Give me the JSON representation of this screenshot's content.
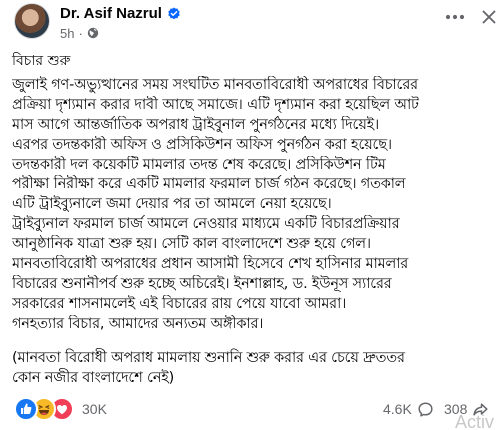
{
  "author": {
    "name": "Dr. Asif Nazrul",
    "verified_icon": "verified-badge-icon",
    "time": "5h",
    "separator": "·",
    "audience_icon": "globe-icon"
  },
  "header": {
    "more_icon": "more-horizontal-icon",
    "close_icon": "close-icon"
  },
  "post": {
    "title": "বিচার শুরু",
    "body_lines": [
      "জুলাই গণ-অভ্যুত্থানের সময় সংঘটিত মানবতাবিরোধী অপরাধের বিচারের",
      "প্রক্রিয়া দৃশ্যমান করার দাবী আছে সমাজে। এটি দৃশ্যমান করা হয়েছিল আট",
      "মাস আগে আন্তর্জাতিক অপরাধ ট্রাইবুনাল পুনর্গঠনের মধ্যে দিয়েই।",
      "এরপর তদন্তকারী অফিস ও প্রসিকিউশন অফিস পুনর্গঠন করা হয়েছে।",
      "তদন্তকারী দল কয়েকটি মামলার তদন্ত শেষ করেছে। প্রসিকিউশন টিম",
      "পরীক্ষা নিরীক্ষা করে একটি মামলার ফরমাল চার্জ গঠন করেছে। গতকাল",
      "এটি ট্রাইব্যুনালে জমা দেয়ার পর তা আমলে নেয়া হয়েছে।",
      "ট্রাইব্যুনাল ফরমাল চার্জ আমলে নেওয়ার মাধ্যমে একটি বিচারপ্রক্রিয়ার",
      "আনুষ্ঠানিক যাত্রা শুরু হয়। সেটি কাল বাংলাদেশে শুরু হয়ে গেল।",
      "মানবতাবিরোধী অপরাধের প্রধান আসামী হিসেবে শেখ হাসিনার মামলার",
      "বিচারের শুনানীপর্ব শুরু হচ্ছে অচিরেই। ইনশাল্লাহ, ড. ইউনূস স্যারের",
      "সরকারের শাসনামলেই এই বিচারের রায় পেয়ে যাবো আমরা।",
      "গনহত্যার বিচার, আমাদের অন্যতম অঙ্গীকার।"
    ],
    "note_lines": [
      "(মানবতা বিরোধী অপরাধ মামলায় শুনানি  শুরু করার এর চেয়ে দ্রুততর",
      "কোন নজীর বাংলাদেশে নেই)"
    ]
  },
  "footer": {
    "reaction_icons": [
      "like-icon",
      "haha-icon",
      "love-icon"
    ],
    "reaction_count": "30K",
    "comment_count": "4.6K",
    "comment_icon": "comment-icon",
    "share_count": "308",
    "share_icon": "share-icon"
  },
  "watermark": "Activ",
  "colors": {
    "text": "#050505",
    "secondary_text": "#65676b",
    "verified_blue": "#0866ff",
    "like_blue": "#1877f2",
    "haha_yellow": "#f7b928",
    "love_red": "#f33e58",
    "background": "#ffffff"
  }
}
